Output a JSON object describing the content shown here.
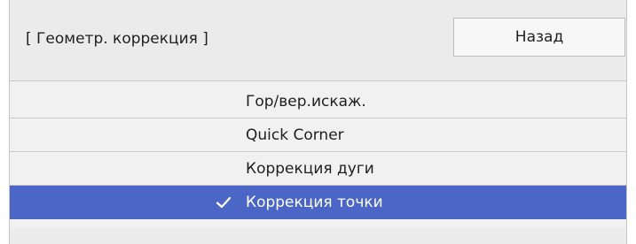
{
  "header": {
    "title": "[ Геометр. коррекция ]",
    "back_button_label": "Назад"
  },
  "menu": {
    "items": [
      {
        "label": "Гор/вер.искаж.",
        "selected": false
      },
      {
        "label": "Quick Corner",
        "selected": false
      },
      {
        "label": "Коррекция дуги",
        "selected": false
      },
      {
        "label": "Коррекция точки",
        "selected": true
      }
    ]
  },
  "colors": {
    "selection_accent": "#4b66c7",
    "panel_background": "#f1f1f1"
  },
  "icons": {
    "selected_indicator": "check-icon"
  }
}
